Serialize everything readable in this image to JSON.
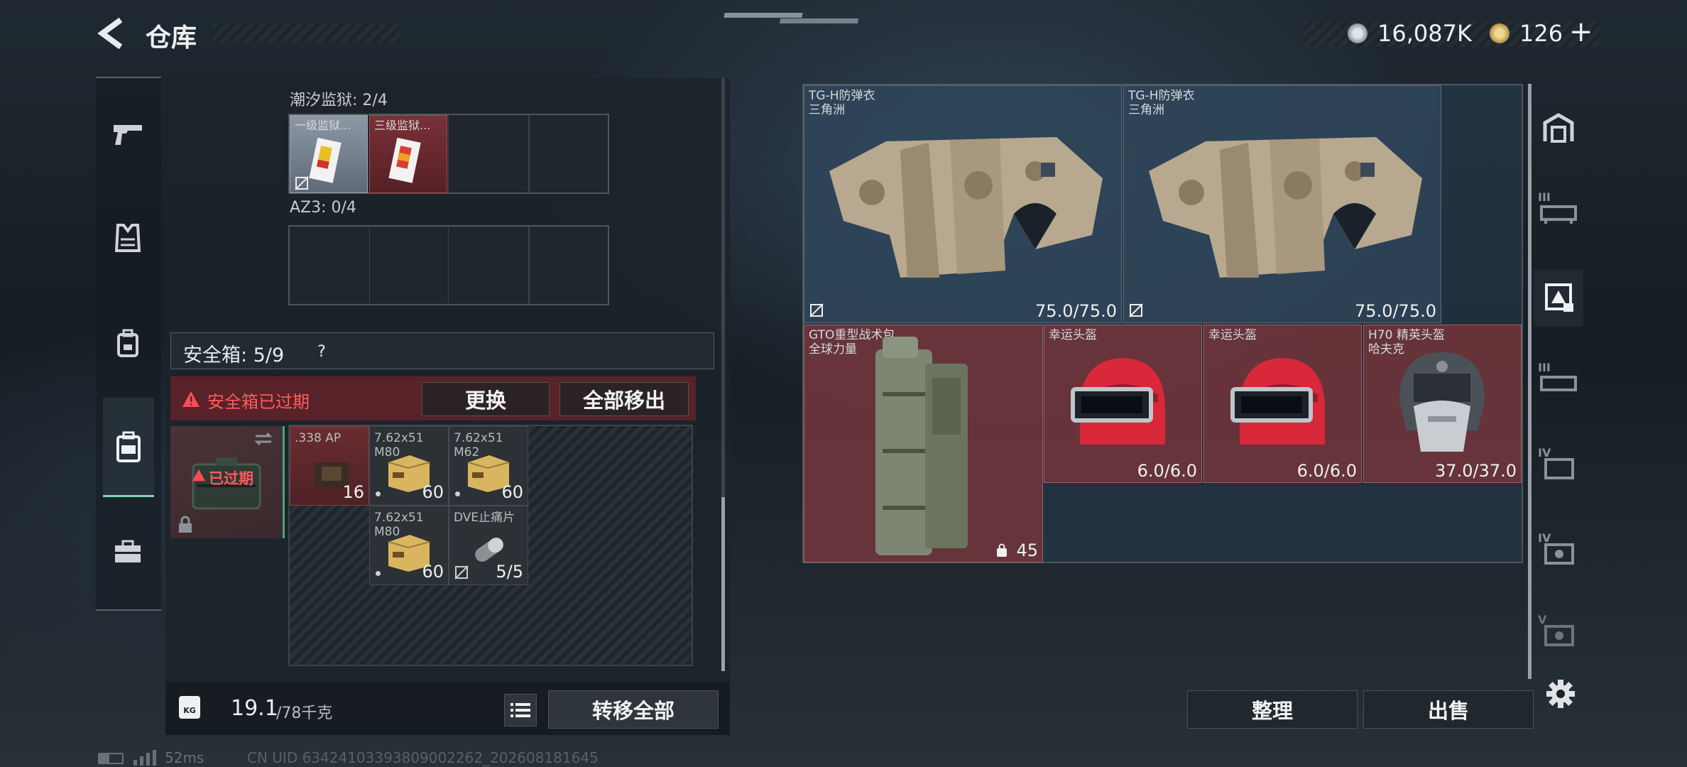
{
  "header": {
    "title": "仓库",
    "currency1": "16,087K",
    "currency2": "126",
    "plus": "+",
    "version": "..."
  },
  "left_nav": {
    "items": [
      "weapons-icon",
      "armor-icon",
      "backpack-icon",
      "safebox-icon",
      "briefcase-icon"
    ]
  },
  "inventory": {
    "section1_label": "潮汐监狱: 2/4",
    "section1_items": [
      {
        "name": "一级监狱..."
      },
      {
        "name": "三级监狱..."
      }
    ],
    "section2_label": "AZ3: 0/4",
    "safebox_label": "安全箱: 5/9",
    "safebox_help": "?",
    "expired_warning": "安全箱已过期",
    "replace_button": "更换",
    "move_all_button": "全部移出",
    "expired_badge": "已过期",
    "safebox_items": [
      {
        "name": ".338 AP",
        "count": "16"
      },
      {
        "name": "7.62x51 M80",
        "count": "60"
      },
      {
        "name": "7.62x51 M62",
        "count": "60"
      },
      {
        "name": "7.62x51 M80",
        "count": "60"
      },
      {
        "name": "DVE止痛片",
        "count": "5/5"
      }
    ],
    "weight": "19.1",
    "weight_max": "/78千克",
    "weight_icon": "KG",
    "transfer_all_button": "转移全部"
  },
  "storage": {
    "items": [
      {
        "name": "TG-H防弹衣",
        "sub": "三角洲",
        "durability": "75.0/75.0"
      },
      {
        "name": "TG-H防弹衣",
        "sub": "三角洲",
        "durability": "75.0/75.0"
      },
      {
        "name": "GTO重型战术包",
        "sub": "全球力量",
        "count": "45"
      },
      {
        "name": "幸运头盔",
        "sub": "",
        "durability": "6.0/6.0"
      },
      {
        "name": "幸运头盔",
        "sub": "",
        "durability": "6.0/6.0"
      },
      {
        "name": "H70 精英头盔",
        "sub": "哈夫克",
        "durability": "37.0/37.0"
      }
    ],
    "sort_button": "整理",
    "sell_button": "出售"
  },
  "right_nav": {
    "items": [
      "storage-home-icon",
      "tier3-icon",
      "tier-special-icon",
      "tier3b-icon",
      "tier4-icon",
      "tier4b-icon",
      "tier5-icon",
      "settings-icon"
    ],
    "labels": [
      "III",
      "III",
      "IV",
      "IV",
      "V"
    ]
  },
  "status": {
    "ping": "52ms",
    "uid": "CN UID 63424103393809002262_202608181645"
  }
}
